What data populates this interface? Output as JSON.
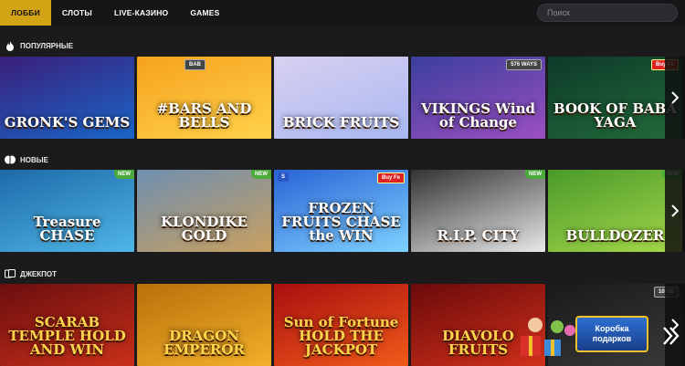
{
  "nav": {
    "tabs": [
      {
        "label": "ЛОББИ",
        "active": true
      },
      {
        "label": "СЛОТЫ"
      },
      {
        "label": "LIVE-КАЗИНО"
      },
      {
        "label": "GAMES"
      }
    ],
    "search_placeholder": "Поиск"
  },
  "sections": [
    {
      "title": "ПОПУЛЯРНЫЕ",
      "icon": "flame-icon",
      "games": [
        {
          "name": "GRONK'S GEMS",
          "colors": [
            "#3a1f7a",
            "#1a66c8"
          ]
        },
        {
          "name": "#BARS AND BELLS",
          "colors": [
            "#f6a21e",
            "#ffd24a"
          ],
          "badge_top": "BAB"
        },
        {
          "name": "BRICK FRUITS",
          "colors": [
            "#d8d0f0",
            "#a9b8f2"
          ]
        },
        {
          "name": "VIKINGS Wind of Change",
          "colors": [
            "#3b3f9c",
            "#9b4fc2"
          ],
          "badge": "576 WAYS"
        },
        {
          "name": "BOOK OF BABA YAGA",
          "colors": [
            "#0e3a2a",
            "#226a3a"
          ],
          "badge": "Buy Fe"
        }
      ]
    },
    {
      "title": "НОВЫЕ",
      "icon": "leaf-icon",
      "games": [
        {
          "name": "Treasure CHASE",
          "colors": [
            "#1d6aa8",
            "#4fb6e8"
          ],
          "badge": "NEW"
        },
        {
          "name": "KLONDIKE GOLD",
          "colors": [
            "#6f8fb0",
            "#c9a060"
          ],
          "badge": "NEW"
        },
        {
          "name": "FROZEN FRUITS CHASE the WIN",
          "colors": [
            "#2a63d6",
            "#7fd2ff"
          ],
          "badge": "Buy Fe",
          "prov": "S"
        },
        {
          "name": "R.I.P. CITY",
          "colors": [
            "#333",
            "#e8e8e8"
          ],
          "badge": "NEW"
        },
        {
          "name": "BULLDOZER",
          "colors": [
            "#4a9a2a",
            "#a6d84a"
          ],
          "badge": "NEW"
        }
      ]
    },
    {
      "title": "ДЖЕКПОТ",
      "icon": "coins-icon",
      "games": [
        {
          "name": "SCARAB TEMPLE HOLD AND WIN",
          "colors": [
            "#6b0e0e",
            "#c9301a"
          ]
        },
        {
          "name": "DRAGON EMPEROR",
          "colors": [
            "#b8700a",
            "#f2b02a"
          ]
        },
        {
          "name": "Sun of Fortune HOLD THE JACKPOT",
          "colors": [
            "#a80f0f",
            "#f25a1a"
          ]
        },
        {
          "name": "DIAVOLO FRUITS",
          "colors": [
            "#6b0a0a",
            "#d0301a"
          ]
        },
        {
          "name": "",
          "colors": [
            "#1a1a1a",
            "#3a3a3a"
          ],
          "badge": "10 GE"
        }
      ]
    }
  ],
  "gift": {
    "line1": "Коробка",
    "line2": "подарков"
  },
  "colors": {
    "accent": "#d4a417",
    "bg": "#1b1b1e",
    "new_badge": "#4caa3c"
  }
}
